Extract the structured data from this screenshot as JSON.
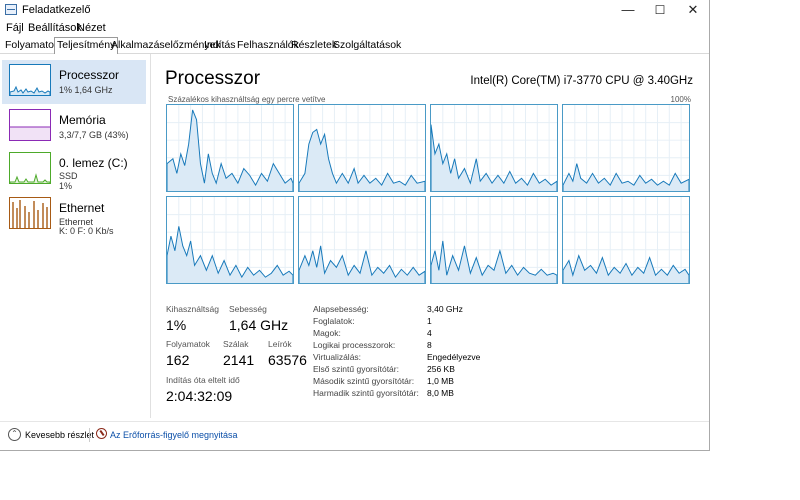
{
  "window": {
    "title": "Feladatkezelő",
    "controls": {
      "minimize": "—",
      "maximize": "☐",
      "close": "✕"
    }
  },
  "menu": [
    "Fájl",
    "Beállítások",
    "Nézet"
  ],
  "tabs": [
    {
      "label": "Folyamatok",
      "active": false
    },
    {
      "label": "Teljesítmény",
      "active": true
    },
    {
      "label": "Alkalmazáselőzmények",
      "active": false
    },
    {
      "label": "Indítás",
      "active": false
    },
    {
      "label": "Felhasználók",
      "active": false
    },
    {
      "label": "Részletek",
      "active": false
    },
    {
      "label": "Szolgáltatások",
      "active": false
    }
  ],
  "resources": [
    {
      "name": "Processzor",
      "sub1": "1% 1,64 GHz",
      "sub2": "",
      "sub3": "",
      "color": "#1779ba",
      "selected": true
    },
    {
      "name": "Memória",
      "sub1": "3,3/7,7 GB (43%)",
      "sub2": "",
      "sub3": "",
      "color": "#8b2ab5",
      "selected": false
    },
    {
      "name": "0. lemez (C:)",
      "sub1": "SSD",
      "sub2": "1%",
      "sub3": "",
      "color": "#4daa2a",
      "selected": false
    },
    {
      "name": "Ethernet",
      "sub1": "Ethernet",
      "sub2": "K: 0  F: 0 Kb/s",
      "sub3": "",
      "color": "#a75a14",
      "selected": false
    }
  ],
  "main": {
    "title": "Processzor",
    "cpu_model": "Intel(R) Core(TM) i7-3770 CPU @ 3.40GHz",
    "graph_caption": "Százalékos kihasználtság egy percre vetítve",
    "graph_max": "100%",
    "graph_color": "#1779ba"
  },
  "stats": {
    "utilization_label": "Kihasználtság",
    "utilization_value": "1%",
    "speed_label": "Sebesség",
    "speed_value": "1,64 GHz",
    "processes_label": "Folyamatok",
    "processes_value": "162",
    "threads_label": "Szálak",
    "threads_value": "2141",
    "handles_label": "Leírók",
    "handles_value": "63576",
    "uptime_label": "Indítás óta eltelt idő",
    "uptime_value": "2:04:32:09"
  },
  "specs": [
    {
      "key": "Alapsebesség:",
      "value": "3,40 GHz"
    },
    {
      "key": "Foglalatok:",
      "value": "1"
    },
    {
      "key": "Magok:",
      "value": "4"
    },
    {
      "key": "Logikai processzorok:",
      "value": "8"
    },
    {
      "key": "Virtualizálás:",
      "value": "Engedélyezve"
    },
    {
      "key": "Első szintű gyorsítótár:",
      "value": "256 KB"
    },
    {
      "key": "Második szintű gyorsítótár:",
      "value": "1,0 MB"
    },
    {
      "key": "Harmadik szintű gyorsítótár:",
      "value": "8,0 MB"
    }
  ],
  "footer": {
    "fewer_details": "Kevesebb részlet",
    "resource_monitor": "Az Erőforrás-figyelő megnyitása"
  },
  "icons": {
    "app": "task-manager-icon",
    "fewer": "chevron-up-circle-icon",
    "monitor": "resource-monitor-icon"
  }
}
